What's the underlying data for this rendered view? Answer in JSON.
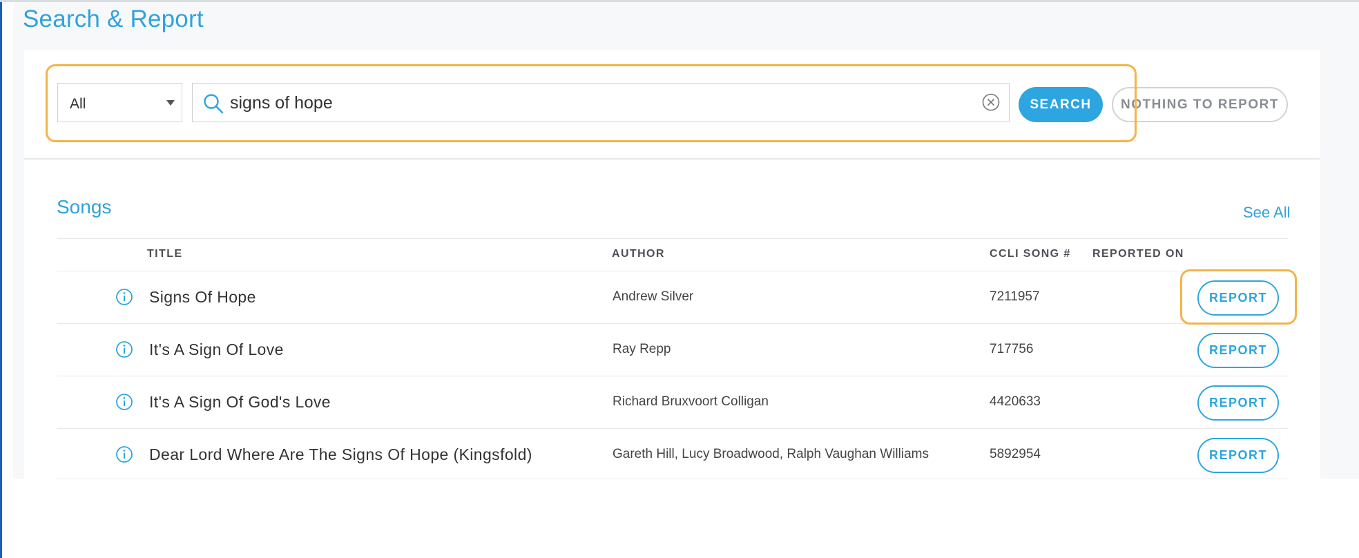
{
  "page": {
    "title": "Search & Report"
  },
  "search": {
    "filter_value": "All",
    "query": "signs of hope",
    "search_label": "SEARCH",
    "nothing_label": "NOTHING TO REPORT"
  },
  "songs": {
    "title": "Songs",
    "see_all": "See All",
    "columns": {
      "title": "TITLE",
      "author": "AUTHOR",
      "ccli": "CCLI SONG #",
      "reported": "REPORTED ON"
    },
    "report_label": "REPORT",
    "rows": [
      {
        "title": "Signs Of Hope",
        "author": "Andrew Silver",
        "ccli": "7211957"
      },
      {
        "title": "It's A Sign Of Love",
        "author": "Ray Repp",
        "ccli": "717756"
      },
      {
        "title": "It's A Sign Of God's Love",
        "author": "Richard Bruxvoort Colligan",
        "ccli": "4420633"
      },
      {
        "title": "Dear Lord Where Are The Signs Of Hope (Kingsfold)",
        "author": "Gareth Hill, Lucy Broadwood, Ralph Vaughan Williams",
        "ccli": "5892954"
      }
    ]
  },
  "icons": {
    "search": "search-icon",
    "clear": "clear-icon",
    "info": "info-icon",
    "dropdown": "chevron-down-icon"
  },
  "colors": {
    "accent": "#2da5e0",
    "highlight": "#f3b447"
  }
}
